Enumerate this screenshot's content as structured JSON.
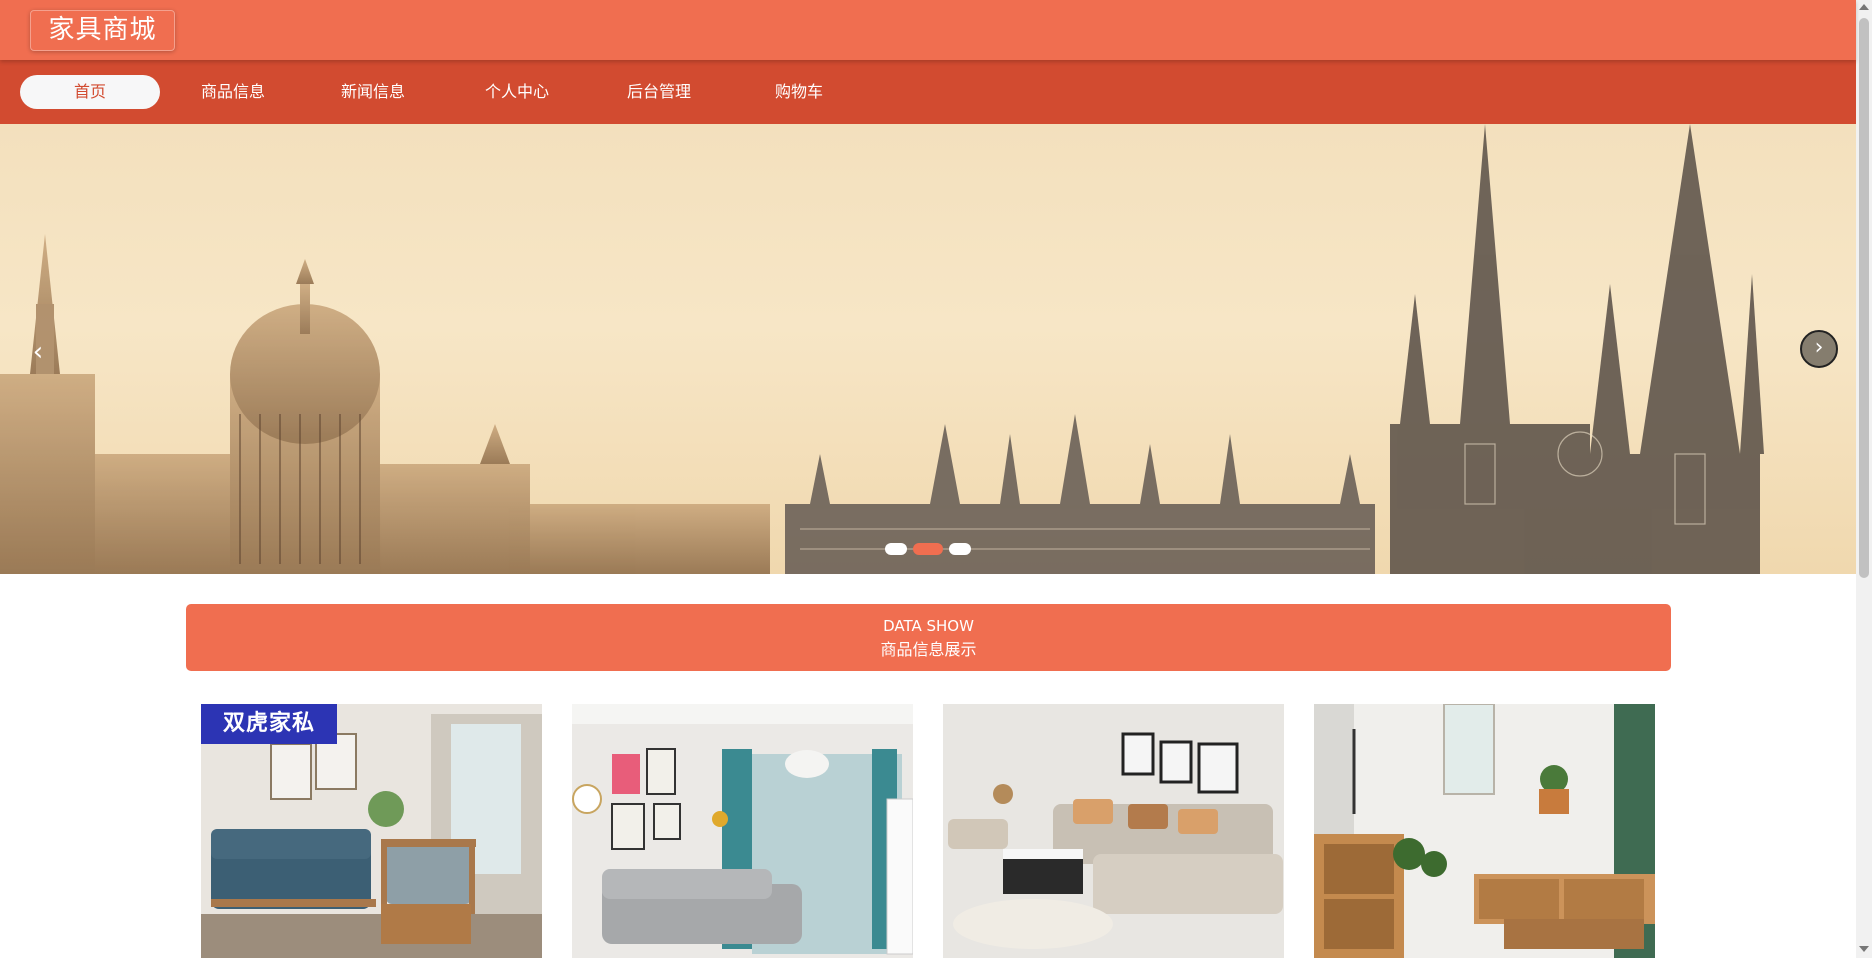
{
  "header": {
    "logo_text": "家具商城"
  },
  "nav": {
    "items": [
      {
        "label": "首页",
        "active": true
      },
      {
        "label": "商品信息",
        "active": false
      },
      {
        "label": "新闻信息",
        "active": false
      },
      {
        "label": "个人中心",
        "active": false
      },
      {
        "label": "后台管理",
        "active": false
      },
      {
        "label": "购物车",
        "active": false
      }
    ]
  },
  "banner": {
    "prev_icon": "chevron-left-icon",
    "next_icon": "chevron-right-icon",
    "slide_count": 3,
    "active_slide": 2
  },
  "section": {
    "title_en": "DATA SHOW",
    "title_cn": "商品信息展示"
  },
  "products": [
    {
      "brand_tag": "双虎家私"
    },
    {
      "brand_tag": ""
    },
    {
      "brand_tag": ""
    },
    {
      "brand_tag": ""
    }
  ],
  "colors": {
    "header": "#f06e50",
    "nav": "#d24b30",
    "accent": "#f06e50"
  }
}
